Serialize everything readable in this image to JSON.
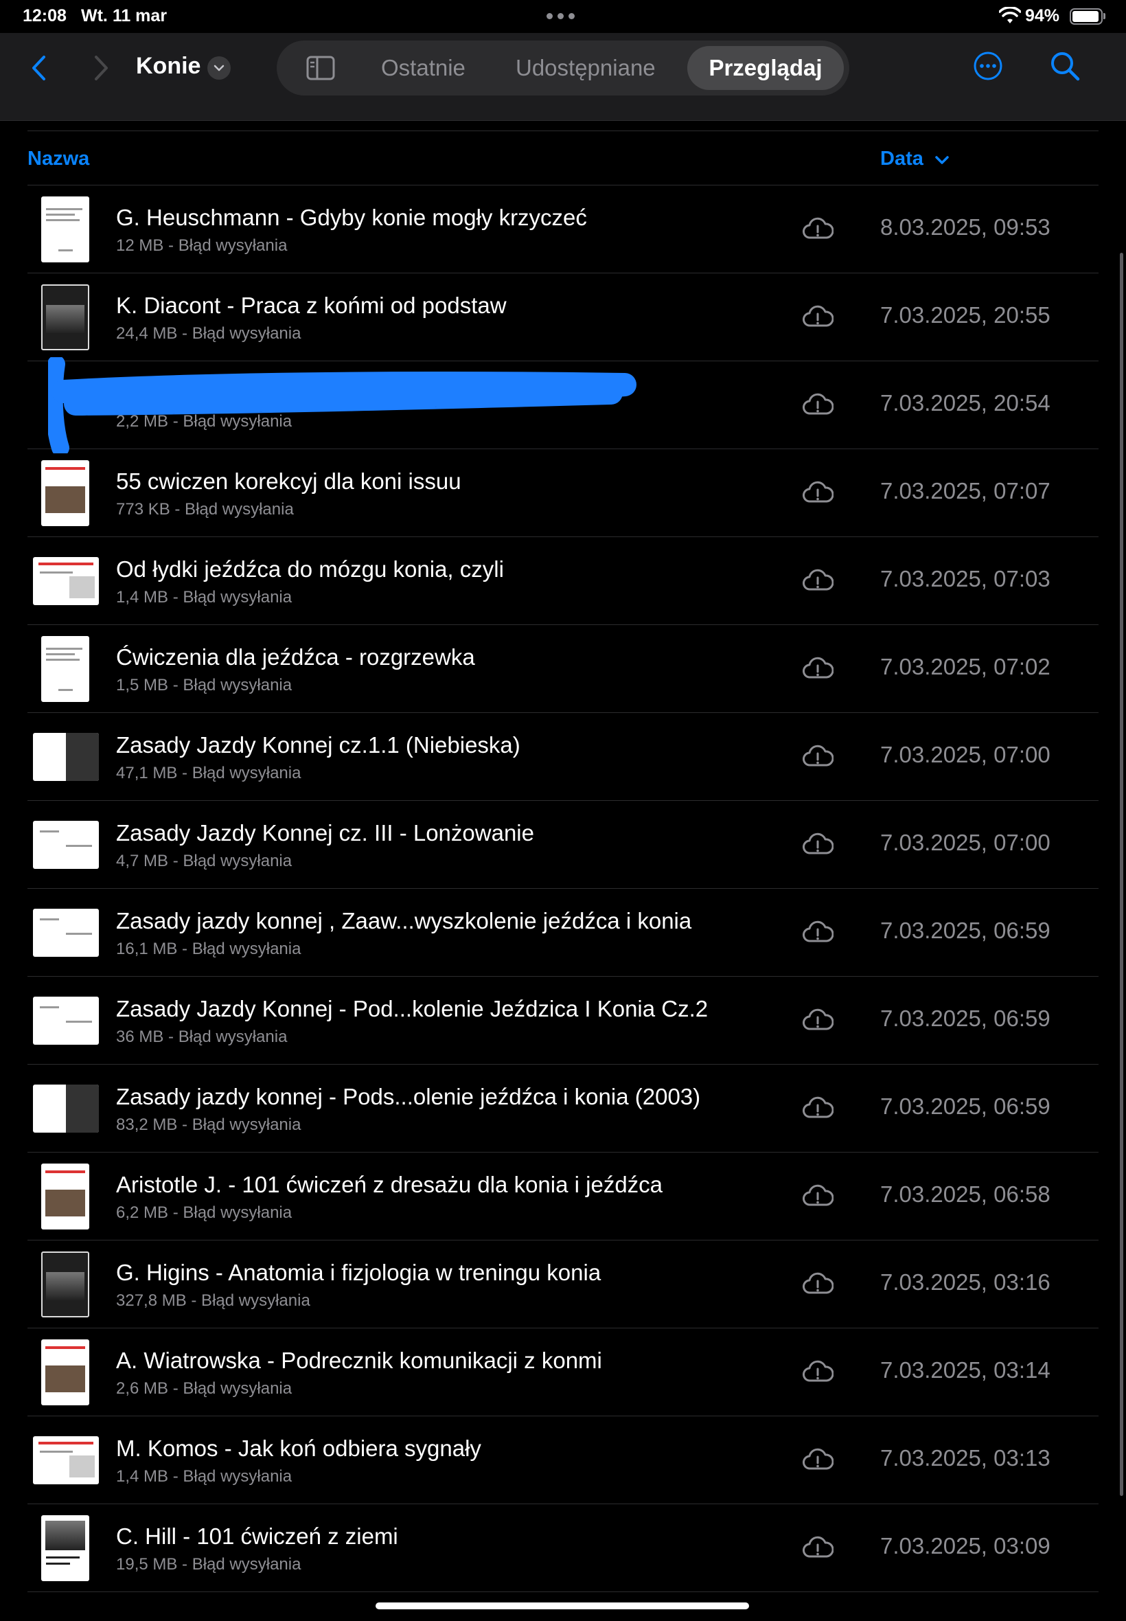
{
  "status_bar": {
    "time": "12:08",
    "date": "Wt. 11 mar",
    "battery": "94%",
    "battery_level": 0.94
  },
  "toolbar": {
    "folder_title": "Konie",
    "tabs": [
      {
        "label": "Ostatnie",
        "selected": false
      },
      {
        "label": "Udostępniane",
        "selected": false
      },
      {
        "label": "Przeglądaj",
        "selected": true
      }
    ]
  },
  "columns": {
    "name": "Nazwa",
    "date": "Data"
  },
  "files": [
    {
      "name": "G. Heuschmann - Gdyby konie mogły krzyczeć",
      "meta": "12 MB - Błąd wysyłania",
      "date": "8.03.2025, 09:53",
      "thumb": "doc"
    },
    {
      "name": "K. Diacont - Praca z końmi od podstaw",
      "meta": "24,4 MB - Błąd wysyłania",
      "date": "7.03.2025, 20:55",
      "thumb": "dark"
    },
    {
      "name": "",
      "meta": "2,2 MB - Błąd wysyłania",
      "date": "7.03.2025, 20:54",
      "thumb": "none"
    },
    {
      "name": "55 cwiczen korekcyj dla koni issuu",
      "meta": "773 KB - Błąd wysyłania",
      "date": "7.03.2025, 07:07",
      "thumb": "photo"
    },
    {
      "name": "Od łydki jeźdźca do mózgu konia, czyli",
      "meta": "1,4 MB - Błąd wysyłania",
      "date": "7.03.2025, 07:03",
      "thumb": "landscape-red"
    },
    {
      "name": "Ćwiczenia dla jeźdźca - rozgrzewka",
      "meta": "1,5 MB - Błąd wysyłania",
      "date": "7.03.2025, 07:02",
      "thumb": "doc"
    },
    {
      "name": "Zasady Jazdy Konnej cz.1.1 (Niebieska)",
      "meta": "47,1 MB - Błąd wysyłania",
      "date": "7.03.2025, 07:00",
      "thumb": "landscape-dark"
    },
    {
      "name": "Zasady Jazdy Konnej cz. III - Lonżowanie",
      "meta": "4,7 MB - Błąd wysyłania",
      "date": "7.03.2025, 07:00",
      "thumb": "landscape"
    },
    {
      "name": "Zasady jazdy konnej , Zaaw...wyszkolenie jeźdźca i konia",
      "meta": "16,1 MB - Błąd wysyłania",
      "date": "7.03.2025, 06:59",
      "thumb": "landscape"
    },
    {
      "name": "Zasady Jazdy Konnej - Pod...kolenie Jeździca I Konia Cz.2",
      "meta": "36 MB - Błąd wysyłania",
      "date": "7.03.2025, 06:59",
      "thumb": "landscape"
    },
    {
      "name": "Zasady jazdy konnej - Pods...olenie jeźdźca i konia (2003)",
      "meta": "83,2 MB - Błąd wysyłania",
      "date": "7.03.2025, 06:59",
      "thumb": "landscape-dark"
    },
    {
      "name": "Aristotle J. - 101 ćwiczeń z dresażu dla konia i jeźdźca",
      "meta": "6,2 MB - Błąd wysyłania",
      "date": "7.03.2025, 06:58",
      "thumb": "photo"
    },
    {
      "name": "G. Higins - Anatomia i fizjologia w treningu konia",
      "meta": "327,8 MB - Błąd wysyłania",
      "date": "7.03.2025, 03:16",
      "thumb": "dark"
    },
    {
      "name": "A. Wiatrowska - Podrecznik komunikacji z konmi",
      "meta": "2,6 MB - Błąd wysyłania",
      "date": "7.03.2025, 03:14",
      "thumb": "photo"
    },
    {
      "name": "M. Komos - Jak koń odbiera sygnały",
      "meta": "1,4 MB - Błąd wysyłania",
      "date": "7.03.2025, 03:13",
      "thumb": "landscape-red"
    },
    {
      "name": "C. Hill - 101 ćwiczeń z ziemi",
      "meta": "19,5 MB - Błąd wysyłania",
      "date": "7.03.2025, 03:09",
      "thumb": "bw"
    }
  ],
  "colors": {
    "accent": "#0a84ff",
    "background": "#000000",
    "redaction": "#1e7fff"
  }
}
